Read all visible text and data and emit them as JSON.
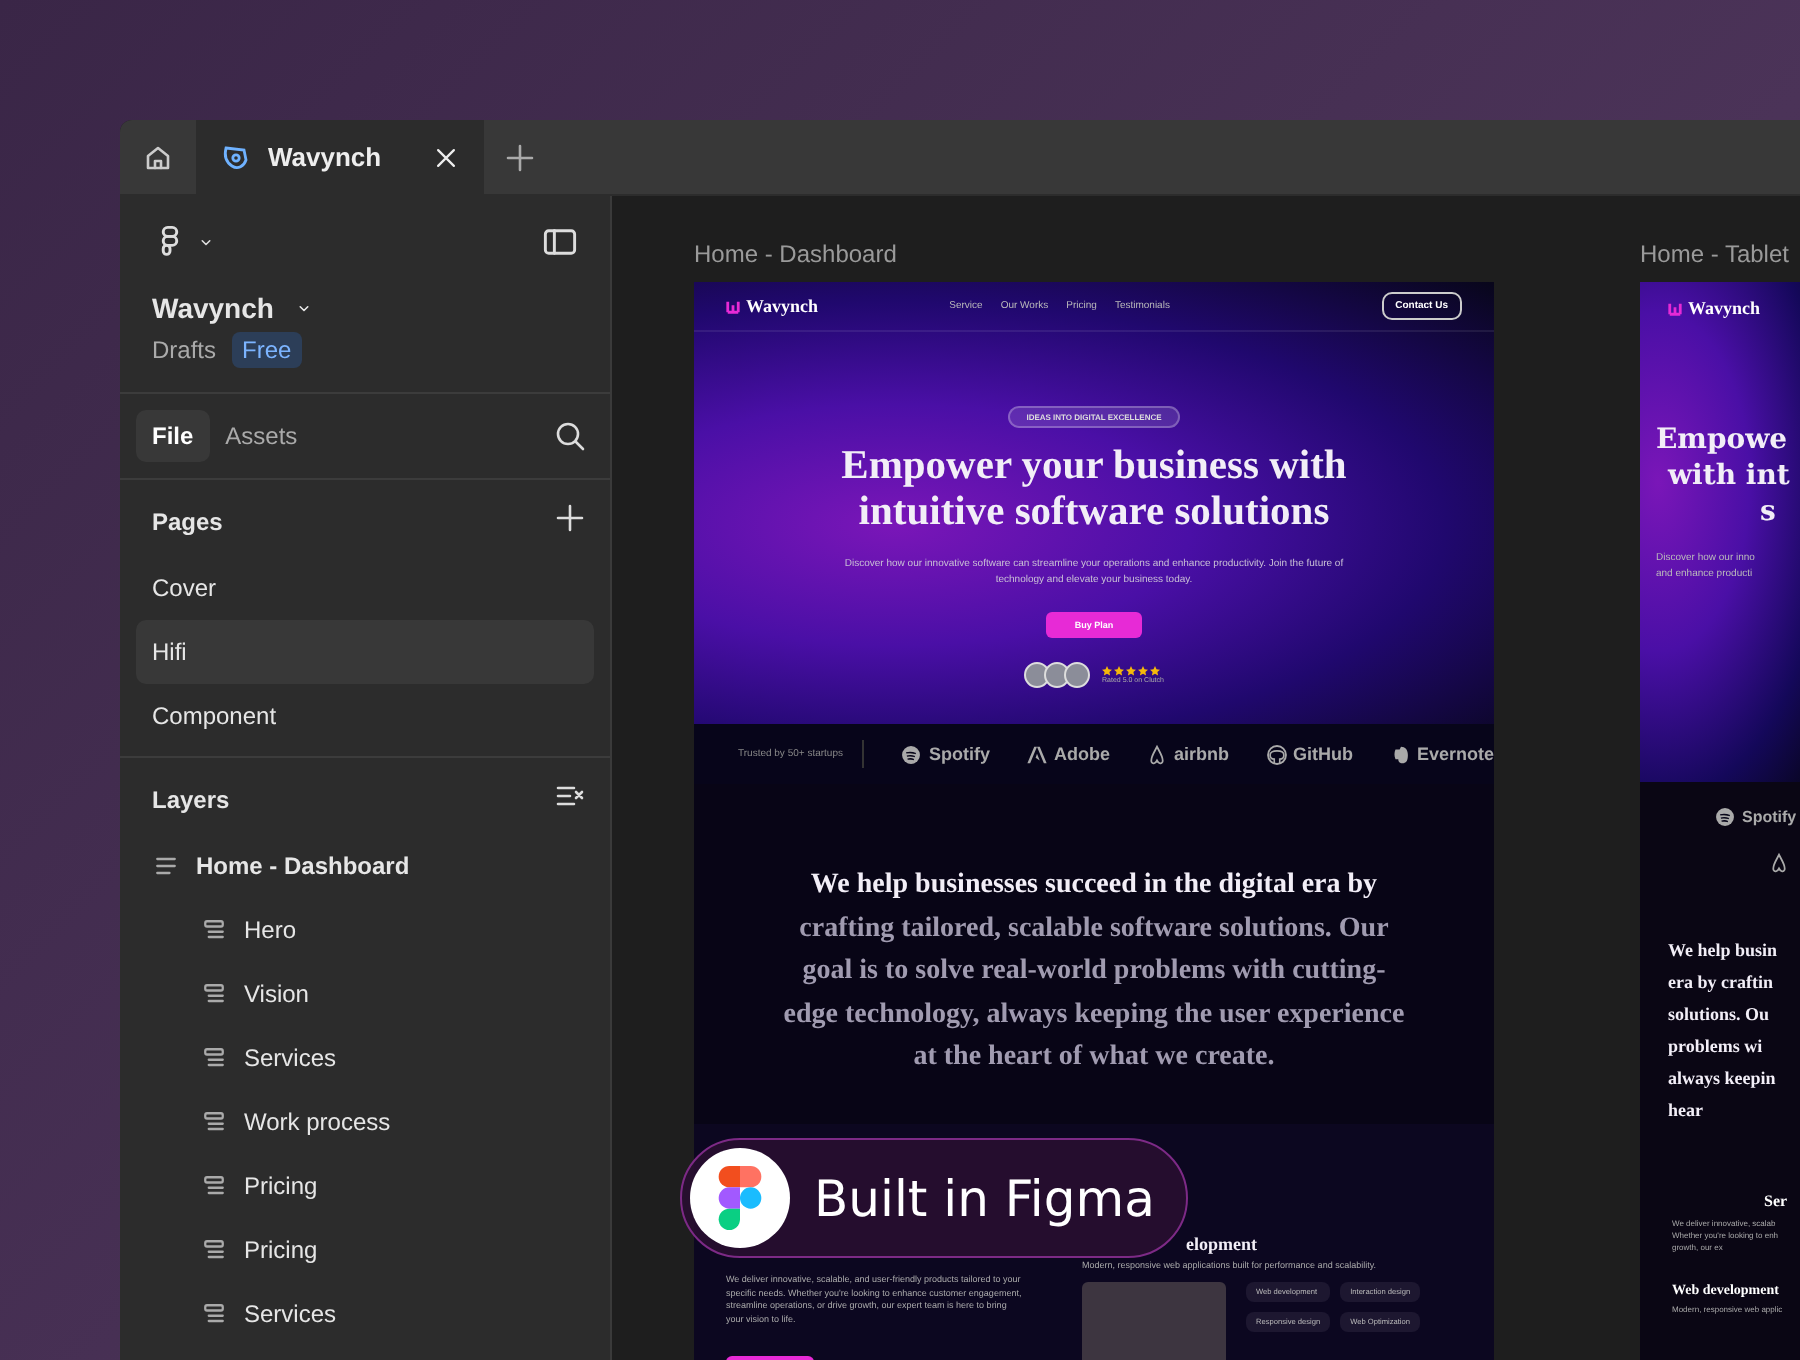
{
  "file_tab": {
    "title": "Wavynch"
  },
  "sidebar": {
    "project": "Wavynch",
    "location": "Drafts",
    "plan_badge": "Free",
    "tabs": [
      {
        "label": "File",
        "selected": true
      },
      {
        "label": "Assets",
        "selected": false
      }
    ],
    "pages_title": "Pages",
    "pages": [
      {
        "name": "Cover",
        "selected": false
      },
      {
        "name": "Hifi",
        "selected": true
      },
      {
        "name": "Component",
        "selected": false
      }
    ],
    "layers_title": "Layers",
    "layers": [
      {
        "name": "Home - Dashboard",
        "kind": "frame",
        "children": [
          {
            "name": "Hero",
            "kind": "section"
          },
          {
            "name": "Vision",
            "kind": "section"
          },
          {
            "name": "Services",
            "kind": "section"
          },
          {
            "name": "Work process",
            "kind": "section"
          },
          {
            "name": "Pricing",
            "kind": "section"
          },
          {
            "name": "Pricing",
            "kind": "section"
          },
          {
            "name": "Services",
            "kind": "section"
          }
        ]
      }
    ]
  },
  "desktop_frame": {
    "label": "Home - Dashboard",
    "nav": {
      "logo": "Wavynch",
      "links": [
        "Service",
        "Our Works",
        "Pricing",
        "Testimonials"
      ],
      "cta": "Contact Us"
    },
    "hero": {
      "eyebrow": "IDEAS INTO DIGITAL EXCELLENCE",
      "title": "Empower your business with intuitive software solutions",
      "subtitle": "Discover how our innovative software can streamline your operations and enhance productivity. Join the future of technology and elevate your business today.",
      "button": "Buy Plan",
      "stars": 5,
      "rating": "Rated 5.0 on Clutch"
    },
    "trusted": {
      "label": "Trusted by 50+ startups",
      "logos": [
        "Spotify",
        "Adobe",
        "airbnb",
        "GitHub",
        "Evernote"
      ]
    },
    "vision": {
      "lead": "We help businesses succeed in the digital era by",
      "rest": "crafting tailored, scalable software solutions. Our goal is to solve real-world problems with cutting-edge technology, always keeping the user experience at the heart of what we create."
    },
    "services": {
      "intro": "We deliver innovative, scalable, and user-friendly products tailored to your specific needs. Whether you're looking to enhance customer engagement, streamline operations, or drive growth, our expert team is here to bring your vision to life.",
      "card_title": "elopment",
      "card_text": "Modern, responsive web applications built for performance and scalability.",
      "tags": [
        "Web development",
        "Interaction design",
        "Responsive design",
        "Web Optimization"
      ]
    }
  },
  "tablet_frame": {
    "label": "Home - Tablet",
    "logo": "Wavynch",
    "title_lines": [
      "Empowe",
      "with int",
      "s"
    ],
    "subtitle_lines": [
      "Discover how our inno",
      "and enhance producti"
    ],
    "logos": [
      "Spotify"
    ],
    "vision_lines": [
      "We help busin",
      "era by craftin",
      "solutions. Ou",
      "problems wi",
      "always keepin",
      "hear"
    ],
    "section_title": "Ser",
    "section_lines": [
      "We deliver innovative, scalab",
      "Whether you're looking to enh",
      "growth, our ex"
    ],
    "card_title": "Web development",
    "card_text": "Modern, responsive web applic"
  },
  "badge": {
    "text": "Built in Figma"
  }
}
